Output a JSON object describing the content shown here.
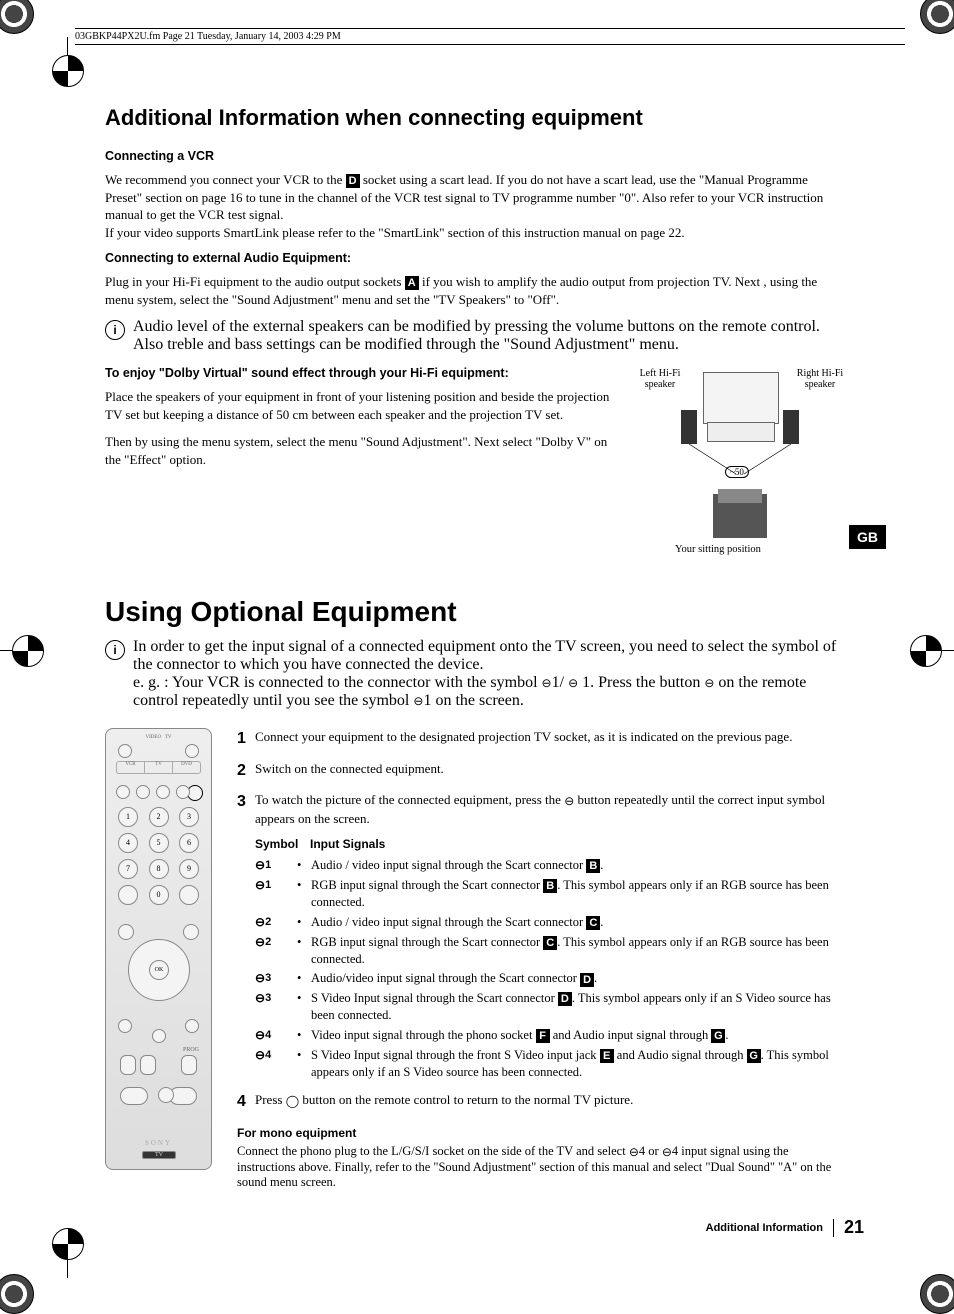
{
  "header_line": "03GBKP44PX2U.fm  Page 21  Tuesday, January 14, 2003  4:29 PM",
  "title1": "Additional Information when connecting equipment",
  "vcr": {
    "heading": "Connecting a VCR",
    "p1a": "We recommend you connect your VCR to the ",
    "letterD": "D",
    "p1b": " socket using a scart lead. If you do not have a scart lead, use the \"Manual Programme Preset\" section on page 16 to tune in the channel of the VCR test signal to TV programme number \"0\". Also refer to your VCR instruction manual to get the VCR test signal.",
    "p2": "If your video supports SmartLink please refer to the \"SmartLink\" section of this instruction manual on page 22."
  },
  "audio": {
    "heading": "Connecting to external Audio Equipment:",
    "p1a": "Plug in your Hi-Fi equipment to the audio output sockets ",
    "letterA": "A",
    "p1b": " if you wish to amplify the audio output from projection TV. Next , using the menu system, select the \"Sound Adjustment\" menu and set the \"TV Speakers\" to \"Off\".",
    "info": "Audio level of the external speakers can be modified by pressing the volume buttons on the remote control. Also treble and bass settings can be modified through the \"Sound Adjustment\" menu."
  },
  "dolby": {
    "heading": "To enjoy \"Dolby Virtual\" sound effect through your Hi-Fi equipment:",
    "p1": "Place the speakers of your equipment in front of your listening position and beside the projection TV set but keeping a distance of 50 cm between each speaker and the projection TV set.",
    "p2": "Then by using the menu system, select the menu \"Sound Adjustment\". Next select \"Dolby V\" on the \"Effect\" option.",
    "left_label": "Left Hi-Fi speaker",
    "right_label": "Right Hi-Fi speaker",
    "dist": "~50",
    "sitting": "Your sitting position"
  },
  "title2": "Using Optional Equipment",
  "opt_info": {
    "l1": "In order to get the input signal of a connected equipment onto the TV screen, you need to select the symbol of the connector to which you have connected the device.",
    "l2a": "e. g. : Your VCR is connected to the connector with the symbol ",
    "l2b": "1/ ",
    "l2c": " 1. Press the button  ",
    "l2d": " on the remote control repeatedly until you see the symbol ",
    "l2e": "1 on the screen."
  },
  "steps": {
    "s1": "Connect your equipment to the designated projection TV socket, as it is indicated on the previous page.",
    "s2": "Switch on the connected equipment.",
    "s3a": "To watch the picture of the connected equipment, press the ",
    "s3b": " button repeatedly until the correct input symbol appears on the screen.",
    "s4a": "Press ",
    "s4b": " button on the remote control to return to the normal TV picture."
  },
  "table": {
    "h1": "Symbol",
    "h2": "Input Signals",
    "rows": [
      {
        "sym": "1",
        "txt_a": "Audio / video input signal through the Scart connector ",
        "letter": "B",
        "txt_b": "."
      },
      {
        "sym": "1",
        "txt_a": "RGB input signal through the Scart connector ",
        "letter": "B",
        "txt_b": ". This symbol appears only if an RGB source has been connected."
      },
      {
        "sym": "2",
        "txt_a": "Audio / video input signal through the Scart connector ",
        "letter": "C",
        "txt_b": "."
      },
      {
        "sym": "2",
        "txt_a": "RGB input signal through the Scart connector ",
        "letter": "C",
        "txt_b": ". This symbol appears only  if an RGB source has been connected."
      },
      {
        "sym": "3",
        "txt_a": "Audio/video input signal through the Scart connector ",
        "letter": "D",
        "txt_b": "."
      },
      {
        "sym": "3",
        "txt_a": "S Video Input signal through the Scart connector ",
        "letter": "D",
        "txt_b": ". This symbol appears only if an S Video source has been connected."
      },
      {
        "sym": "4",
        "txt_a": "Video input signal through the phono socket ",
        "letter": "F",
        "txt_b": " and Audio input signal through ",
        "letter2": "G",
        "txt_c": "."
      },
      {
        "sym": "4",
        "txt_a": "S Video Input signal through the front S Video input jack ",
        "letter": "E",
        "txt_b": " and Audio signal through ",
        "letter2": "G",
        "txt_c": ". This symbol appears only if an S Video source has been connected."
      }
    ]
  },
  "mono": {
    "heading": "For mono equipment",
    "p_a": "Connect the phono plug to the L/G/S/I socket on the side of the TV and select  ",
    "p_b": "4 or  ",
    "p_c": "4 input signal using the instructions above. Finally, refer to the \"Sound Adjustment\" section of this manual and select \"Dual Sound\" \"A\" on the sound menu screen."
  },
  "gb": "GB",
  "footer": {
    "section": "Additional Information",
    "page": "21"
  },
  "info_i": "i"
}
